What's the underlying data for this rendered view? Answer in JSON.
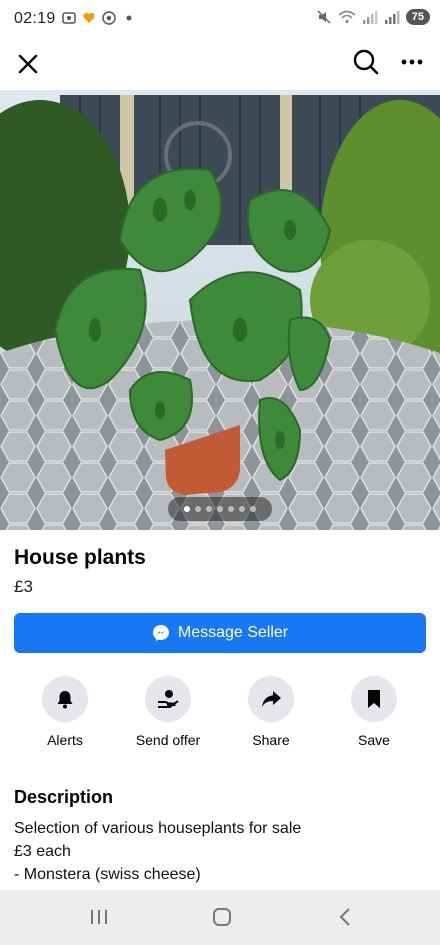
{
  "status_bar": {
    "time": "02:19",
    "battery": "75"
  },
  "listing": {
    "title": "House plants",
    "price": "£3",
    "image_count": 7,
    "active_image": 1
  },
  "message_button": {
    "label": "Message Seller"
  },
  "actions": [
    {
      "label": "Alerts",
      "icon": "bell-icon"
    },
    {
      "label": "Send offer",
      "icon": "send-offer-icon"
    },
    {
      "label": "Share",
      "icon": "share-arrow-icon"
    },
    {
      "label": "Save",
      "icon": "bookmark-icon"
    }
  ],
  "description": {
    "heading": "Description",
    "text": "Selection of various houseplants for sale\n£3 each\n- Monstera (swiss cheese)"
  },
  "colors": {
    "accent": "#1877f2",
    "action_circle": "#e4e6eb",
    "nav_bar": "#ecedef"
  }
}
